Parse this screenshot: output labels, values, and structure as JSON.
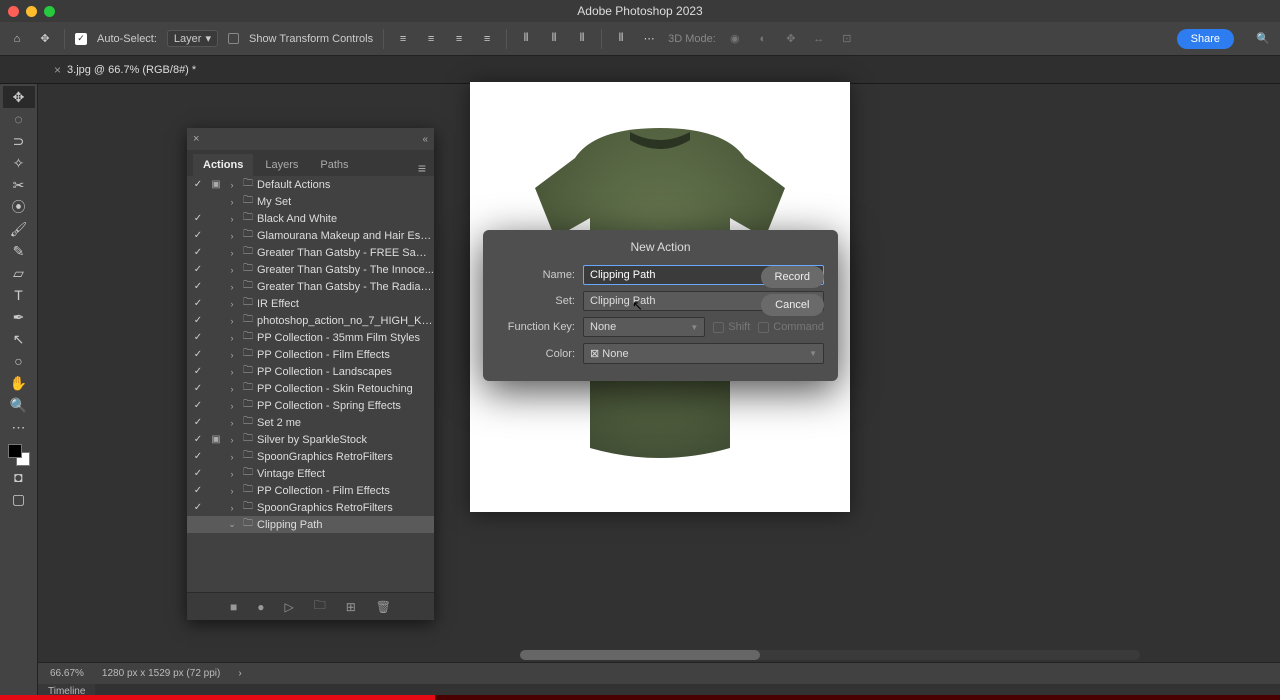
{
  "app": {
    "title": "Adobe Photoshop 2023"
  },
  "options": {
    "auto_select_label": "Auto-Select:",
    "auto_select_target": "Layer",
    "transform_label": "Show Transform Controls",
    "mode3d": "3D Mode:",
    "share": "Share"
  },
  "tab": {
    "doc": "3.jpg @ 66.7% (RGB/8#) *"
  },
  "panel": {
    "tabs": {
      "actions": "Actions",
      "layers": "Layers",
      "paths": "Paths"
    },
    "items": [
      {
        "name": "Default Actions",
        "chk": true,
        "mod": true
      },
      {
        "name": "My Set",
        "chk": false,
        "mod": false
      },
      {
        "name": "Black And White",
        "chk": true,
        "mod": false
      },
      {
        "name": "Glamourana Makeup and Hair Ess...",
        "chk": true,
        "mod": false
      },
      {
        "name": "Greater Than Gatsby - FREE Samp...",
        "chk": true,
        "mod": false
      },
      {
        "name": "Greater Than Gatsby - The Innoce...",
        "chk": true,
        "mod": false
      },
      {
        "name": "Greater Than Gatsby - The Radian...",
        "chk": true,
        "mod": false
      },
      {
        "name": "IR Effect",
        "chk": true,
        "mod": false
      },
      {
        "name": "photoshop_action_no_7_HIGH_KE...",
        "chk": true,
        "mod": false
      },
      {
        "name": "PP Collection - 35mm Film Styles",
        "chk": true,
        "mod": false
      },
      {
        "name": "PP Collection - Film Effects",
        "chk": true,
        "mod": false
      },
      {
        "name": "PP Collection - Landscapes",
        "chk": true,
        "mod": false
      },
      {
        "name": "PP Collection - Skin Retouching",
        "chk": true,
        "mod": false
      },
      {
        "name": "PP Collection - Spring Effects",
        "chk": true,
        "mod": false
      },
      {
        "name": "Set 2 me",
        "chk": true,
        "mod": false
      },
      {
        "name": "Silver by SparkleStock",
        "chk": true,
        "mod": true
      },
      {
        "name": "SpoonGraphics RetroFilters",
        "chk": true,
        "mod": false
      },
      {
        "name": "Vintage Effect",
        "chk": true,
        "mod": false
      },
      {
        "name": "PP Collection - Film Effects",
        "chk": true,
        "mod": false
      },
      {
        "name": "SpoonGraphics RetroFilters",
        "chk": true,
        "mod": false
      },
      {
        "name": "Clipping Path",
        "chk": false,
        "mod": false,
        "open": true,
        "selected": true
      }
    ]
  },
  "modal": {
    "title": "New Action",
    "name_label": "Name:",
    "name_value": "Clipping Path",
    "set_label": "Set:",
    "set_value": "Clipping Path",
    "fn_label": "Function Key:",
    "fn_value": "None",
    "shift": "Shift",
    "command": "Command",
    "color_label": "Color:",
    "color_value": "None",
    "record": "Record",
    "cancel": "Cancel"
  },
  "status": {
    "zoom": "66.67%",
    "dims": "1280 px x 1529 px (72 ppi)",
    "timeline": "Timeline"
  }
}
